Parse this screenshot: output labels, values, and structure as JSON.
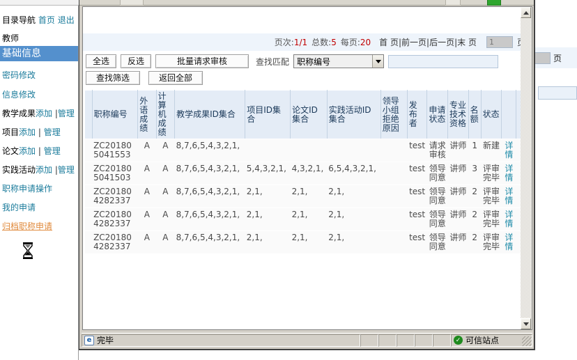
{
  "sidebar": {
    "nav_label": "目录导航",
    "home_link": "首页",
    "logout_link": "退出",
    "role": "教师",
    "selected_item": "基础信息",
    "items": [
      {
        "label": "密码修改"
      },
      {
        "label": "信息修改"
      }
    ],
    "group_items": [
      {
        "prefix": "教学成果",
        "add": "添加",
        "sep": "|",
        "manage": "管理"
      },
      {
        "prefix": "项目",
        "add": "添加",
        "sep": "|",
        "manage": "管理"
      },
      {
        "prefix": "论文",
        "add": "添加",
        "sep": "|",
        "manage": "管理"
      },
      {
        "prefix": "实践活动",
        "add": "添加",
        "sep": "|",
        "manage": "管理"
      }
    ],
    "tail_items": [
      {
        "label": "职称申请操作"
      },
      {
        "label": "我的申请"
      }
    ],
    "highlight_item": "归档职称申请",
    "cursor": "hourglass-cursor"
  },
  "pagination": {
    "page_label": "页次:",
    "page_value": "1/1",
    "total_label": "总数:",
    "total_value": "5",
    "perpage_label": "每页:",
    "perpage_value": "20",
    "first": "首 页",
    "sep1": "|",
    "prev": "前一页",
    "sep2": "|",
    "next": "后一页",
    "sep3": "|",
    "last": "末 页",
    "input_value": "1",
    "input_suffix": "页"
  },
  "toolbar": {
    "select_all": "全选",
    "invert_select": "反选",
    "batch_review": "批量请求审核",
    "match_label": "查找匹配",
    "match_field": "职称编号",
    "match_options": [
      "职称编号"
    ],
    "search_value": "",
    "find_filter": "查找筛选",
    "return_all": "返回全部"
  },
  "table": {
    "columns": [
      "职称编号",
      "外语成绩",
      "计算机成绩",
      "教学成果ID集合",
      "项目ID集合",
      "论文ID集合",
      "实践活动ID集合",
      "领导小组拒绝原因",
      "发布者",
      "申请状态",
      "专业技术资格",
      "名额",
      "状态",
      "",
      ""
    ],
    "rows": [
      {
        "code": "ZC201805041553",
        "foreign": "A",
        "computer": "A",
        "teaching_ids": "8,7,6,5,4,3,2,1,",
        "project_ids": "",
        "paper_ids": "",
        "practice_ids": "",
        "reject_reason": "",
        "publisher": "test",
        "apply_status": "请求审核",
        "qualification": "讲师",
        "quota": "1",
        "status": "新建",
        "detail": "详情"
      },
      {
        "code": "ZC201805041503",
        "foreign": "A",
        "computer": "A",
        "teaching_ids": "8,7,6,5,4,3,2,1,",
        "project_ids": "5,4,3,2,1,",
        "paper_ids": "4,3,2,1,",
        "practice_ids": "6,5,4,3,2,1,",
        "reject_reason": "",
        "publisher": "test",
        "apply_status": "领导同意",
        "qualification": "讲师",
        "quota": "3",
        "status": "评审完毕",
        "detail": "详情"
      },
      {
        "code": "ZC201804282337",
        "foreign": "A",
        "computer": "A",
        "teaching_ids": "8,7,6,5,4,3,2,1,",
        "project_ids": "2,1,",
        "paper_ids": "2,1,",
        "practice_ids": "2,1,",
        "reject_reason": "",
        "publisher": "test",
        "apply_status": "领导同意",
        "qualification": "讲师",
        "quota": "2",
        "status": "评审完毕",
        "detail": "详情"
      },
      {
        "code": "ZC201804282337",
        "foreign": "A",
        "computer": "A",
        "teaching_ids": "8,7,6,5,4,3,2,1,",
        "project_ids": "2,1,",
        "paper_ids": "2,1,",
        "practice_ids": "2,1,",
        "reject_reason": "",
        "publisher": "test",
        "apply_status": "领导同意",
        "qualification": "讲师",
        "quota": "2",
        "status": "评审完毕",
        "detail": "详情"
      },
      {
        "code": "ZC201804282337",
        "foreign": "A",
        "computer": "A",
        "teaching_ids": "8,7,6,5,4,3,2,1,",
        "project_ids": "2,1,",
        "paper_ids": "2,1,",
        "practice_ids": "2,1,",
        "reject_reason": "",
        "publisher": "test",
        "apply_status": "领导同意",
        "qualification": "讲师",
        "quota": "2",
        "status": "评审完毕",
        "detail": "详情"
      }
    ]
  },
  "status_bar": {
    "message": "完毕",
    "zone": "可信站点",
    "browser_icon": "internet-explorer-icon",
    "zone_icon": "trusted-check-icon"
  },
  "background_page": {
    "page_suffix": "页"
  },
  "colors": {
    "selected_nav_bg": "#5490cd",
    "link": "#1f8ba8",
    "highlight": "#e08a3c",
    "accent_red": "#c00000",
    "header_bg": "#e4ecf6",
    "nav_bar_bg": "#eef4fb"
  }
}
